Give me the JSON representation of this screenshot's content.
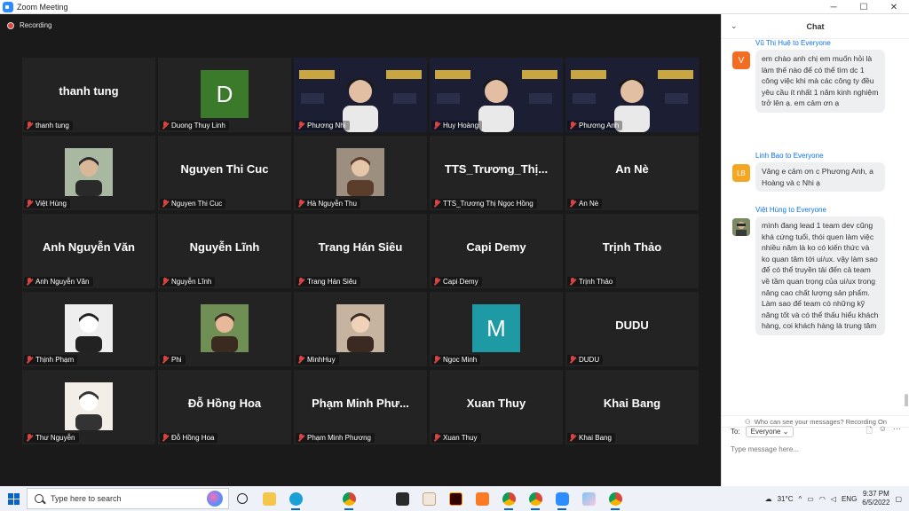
{
  "window": {
    "title": "Zoom Meeting",
    "minimize": "─",
    "maximize": "☐",
    "close": "✕"
  },
  "recording": {
    "label": "Recording"
  },
  "tiles": [
    {
      "label": "thanh tung",
      "big": "thanh tung",
      "kind": "name"
    },
    {
      "label": "Duong Thuy Linh",
      "kind": "letter",
      "letter": "D",
      "color": "#3a7a2a"
    },
    {
      "label": "Phương Nhi",
      "kind": "video"
    },
    {
      "label": "Huy Hoàng",
      "kind": "video",
      "active": true
    },
    {
      "label": "Phương Anh",
      "kind": "video"
    },
    {
      "label": "Việt Hùng",
      "kind": "photo"
    },
    {
      "label": "Nguyen Thi Cuc",
      "big": "Nguyen Thi Cuc",
      "kind": "name"
    },
    {
      "label": "Hà Nguyễn Thu",
      "kind": "photo"
    },
    {
      "label": "TTS_Trương Thị Ngọc Hồng",
      "big": "TTS_Trương_Thị...",
      "kind": "name"
    },
    {
      "label": "An Nè",
      "big": "An Nè",
      "kind": "name"
    },
    {
      "label": "Anh Nguyễn Văn",
      "big": "Anh Nguyễn Văn",
      "kind": "name"
    },
    {
      "label": "Nguyễn Lĩnh",
      "big": "Nguyễn Lĩnh",
      "kind": "name"
    },
    {
      "label": "Trang Hán Siêu",
      "big": "Trang Hán Siêu",
      "kind": "name"
    },
    {
      "label": "Capi Demy",
      "big": "Capi Demy",
      "kind": "name"
    },
    {
      "label": "Trịnh Thảo",
      "big": "Trịnh Thảo",
      "kind": "name"
    },
    {
      "label": "Thịnh Phạm",
      "kind": "photo"
    },
    {
      "label": "Phi",
      "kind": "photo"
    },
    {
      "label": "MinhHuy",
      "kind": "photo"
    },
    {
      "label": "Ngoc Minh",
      "kind": "letter",
      "letter": "M",
      "color": "#1e9aa5"
    },
    {
      "label": "DUDU",
      "big": "DUDU",
      "kind": "name"
    },
    {
      "label": "Thư Nguyễn",
      "kind": "photo"
    },
    {
      "label": "Đỗ Hồng Hoa",
      "big": "Đỗ Hồng Hoa",
      "kind": "name"
    },
    {
      "label": "Phạm Minh Phương",
      "big": "Phạm Minh Phư...",
      "kind": "name"
    },
    {
      "label": "Xuan Thuy",
      "big": "Xuan Thuy",
      "kind": "name"
    },
    {
      "label": "Khai Bang",
      "big": "Khai Bang",
      "kind": "name"
    }
  ],
  "chat": {
    "title": "Chat",
    "messages": [
      {
        "sender": "Vũ Thị Huệ",
        "to": "to Everyone",
        "avatar": "V",
        "color": "#f26d21",
        "text": "em chào anh chị em muốn hỏi là làm thế nào để có thể tìm dc 1 công việc khi mà các công ty đều yêu cầu ít nhất 1 năm kinh nghiệm trở lên ạ. em cảm ơn ạ"
      },
      {
        "sender": "Linh Bao",
        "to": "to Everyone",
        "avatar": "LB",
        "color": "#f5a623",
        "text": "Vâng e cảm ơn c Phương Anh, a Hoàng và c Nhi ạ"
      },
      {
        "sender": "Việt Hùng",
        "to": "to Everyone",
        "avatar": "",
        "color": "#5a6a4a",
        "text": "mình đang lead 1 team dev cũng khá cứng tuổi, thói quen làm việc nhiều năm là ko có kiến thức và ko quan tâm tới ui/ux. vậy làm sao để có thể truyền tải đến cả team về tầm quan trọng của ui/ux trong nâng cao chất lượng sản phẩm. Làm sao để team có những kỹ năng tốt và có thể thấu hiểu khách hàng, coi khách hàng là trung tâm"
      }
    ],
    "privacy": "Who can see your messages? Recording On",
    "to_label": "To:",
    "to_value": "Everyone",
    "input_placeholder": "Type message here..."
  },
  "taskbar": {
    "search_placeholder": "Type here to search",
    "weather": "31°C",
    "lang": "ENG",
    "time": "9:37 PM",
    "date": "6/5/2022"
  }
}
